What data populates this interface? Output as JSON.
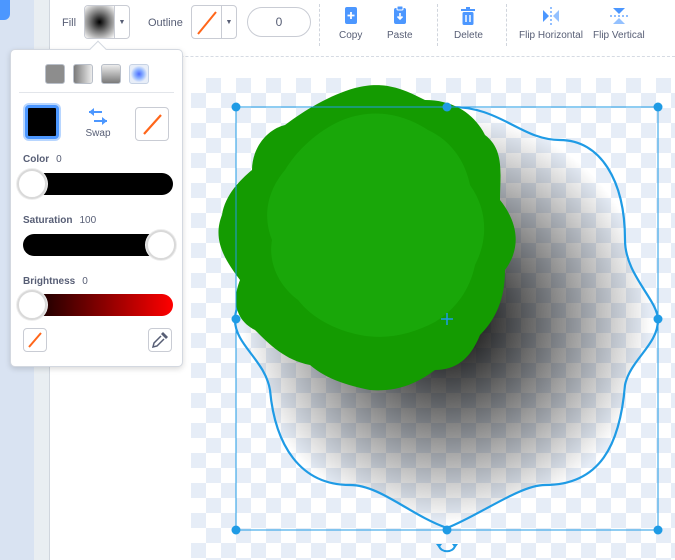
{
  "toolbar": {
    "fill_label": "Fill",
    "outline_label": "Outline",
    "outline_width": "0",
    "tools": [
      {
        "label": "Copy",
        "icon": "copy-icon"
      },
      {
        "label": "Paste",
        "icon": "paste-icon"
      },
      {
        "label": "Delete",
        "icon": "delete-icon"
      },
      {
        "label": "Flip Horizontal",
        "icon": "flip-horizontal-icon"
      },
      {
        "label": "Flip Vertical",
        "icon": "flip-vertical-icon"
      }
    ]
  },
  "popover": {
    "fill_types": [
      "solid",
      "horizontal-gradient",
      "vertical-gradient",
      "radial-gradient"
    ],
    "selected_fill_type": "radial-gradient",
    "swap_label": "Swap",
    "sliders": [
      {
        "label": "Color",
        "value": "0"
      },
      {
        "label": "Saturation",
        "value": "100"
      },
      {
        "label": "Brightness",
        "value": "0"
      }
    ],
    "primary_color": "#000000"
  },
  "colors": {
    "accent": "#4c97ff",
    "selection": "#1f9be5",
    "shape_green": "#149b01",
    "no_color_line": "#ff661a"
  }
}
